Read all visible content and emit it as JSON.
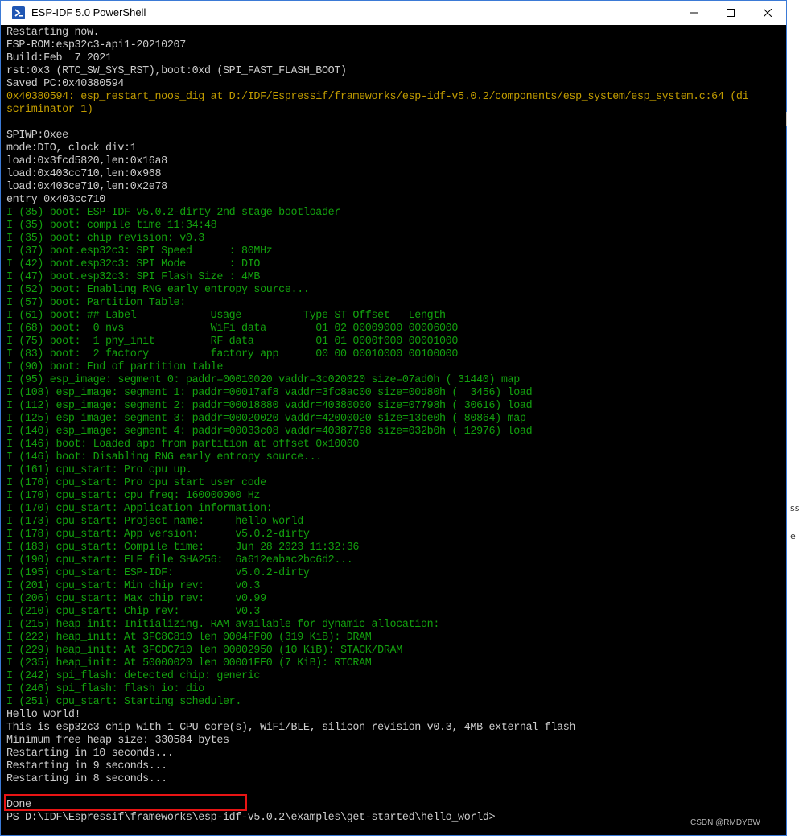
{
  "window": {
    "title": "ESP-IDF 5.0 PowerShell",
    "app_icon": "powershell-icon",
    "controls": [
      "minimize-icon",
      "maximize-icon",
      "close-icon"
    ]
  },
  "terminal": {
    "colors": {
      "default": "#c0c0c0",
      "log_info": "#13a10e",
      "warning": "#c19c00",
      "background": "#000000"
    },
    "lines": [
      {
        "text": "Restarting now.",
        "color": "gray"
      },
      {
        "text": "ESP-ROM:esp32c3-api1-20210207",
        "color": "gray"
      },
      {
        "text": "Build:Feb  7 2021",
        "color": "gray"
      },
      {
        "text": "rst:0x3 (RTC_SW_SYS_RST),boot:0xd (SPI_FAST_FLASH_BOOT)",
        "color": "gray"
      },
      {
        "text": "Saved PC:0x40380594",
        "color": "gray"
      },
      {
        "text": "0x40380594: esp_restart_noos_dig at D:/IDF/Espressif/frameworks/esp-idf-v5.0.2/components/esp_system/esp_system.c:64 (di",
        "color": "yellow"
      },
      {
        "text": "scriminator 1)",
        "color": "yellow"
      },
      {
        "text": "",
        "color": "gray"
      },
      {
        "text": "SPIWP:0xee",
        "color": "gray"
      },
      {
        "text": "mode:DIO, clock div:1",
        "color": "gray"
      },
      {
        "text": "load:0x3fcd5820,len:0x16a8",
        "color": "gray"
      },
      {
        "text": "load:0x403cc710,len:0x968",
        "color": "gray"
      },
      {
        "text": "load:0x403ce710,len:0x2e78",
        "color": "gray"
      },
      {
        "text": "entry 0x403cc710",
        "color": "gray"
      },
      {
        "text": "I (35) boot: ESP-IDF v5.0.2-dirty 2nd stage bootloader",
        "color": "green"
      },
      {
        "text": "I (35) boot: compile time 11:34:48",
        "color": "green"
      },
      {
        "text": "I (35) boot: chip revision: v0.3",
        "color": "green"
      },
      {
        "text": "I (37) boot.esp32c3: SPI Speed      : 80MHz",
        "color": "green"
      },
      {
        "text": "I (42) boot.esp32c3: SPI Mode       : DIO",
        "color": "green"
      },
      {
        "text": "I (47) boot.esp32c3: SPI Flash Size : 4MB",
        "color": "green"
      },
      {
        "text": "I (52) boot: Enabling RNG early entropy source...",
        "color": "green"
      },
      {
        "text": "I (57) boot: Partition Table:",
        "color": "green"
      },
      {
        "text": "I (61) boot: ## Label            Usage          Type ST Offset   Length",
        "color": "green"
      },
      {
        "text": "I (68) boot:  0 nvs              WiFi data        01 02 00009000 00006000",
        "color": "green"
      },
      {
        "text": "I (75) boot:  1 phy_init         RF data          01 01 0000f000 00001000",
        "color": "green"
      },
      {
        "text": "I (83) boot:  2 factory          factory app      00 00 00010000 00100000",
        "color": "green"
      },
      {
        "text": "I (90) boot: End of partition table",
        "color": "green"
      },
      {
        "text": "I (95) esp_image: segment 0: paddr=00010020 vaddr=3c020020 size=07ad0h ( 31440) map",
        "color": "green"
      },
      {
        "text": "I (108) esp_image: segment 1: paddr=00017af8 vaddr=3fc8ac00 size=00d80h (  3456) load",
        "color": "green"
      },
      {
        "text": "I (112) esp_image: segment 2: paddr=00018880 vaddr=40380000 size=07798h ( 30616) load",
        "color": "green"
      },
      {
        "text": "I (125) esp_image: segment 3: paddr=00020020 vaddr=42000020 size=13be0h ( 80864) map",
        "color": "green"
      },
      {
        "text": "I (140) esp_image: segment 4: paddr=00033c08 vaddr=40387798 size=032b0h ( 12976) load",
        "color": "green"
      },
      {
        "text": "I (146) boot: Loaded app from partition at offset 0x10000",
        "color": "green"
      },
      {
        "text": "I (146) boot: Disabling RNG early entropy source...",
        "color": "green"
      },
      {
        "text": "I (161) cpu_start: Pro cpu up.",
        "color": "green"
      },
      {
        "text": "I (170) cpu_start: Pro cpu start user code",
        "color": "green"
      },
      {
        "text": "I (170) cpu_start: cpu freq: 160000000 Hz",
        "color": "green"
      },
      {
        "text": "I (170) cpu_start: Application information:",
        "color": "green"
      },
      {
        "text": "I (173) cpu_start: Project name:     hello_world",
        "color": "green"
      },
      {
        "text": "I (178) cpu_start: App version:      v5.0.2-dirty",
        "color": "green"
      },
      {
        "text": "I (183) cpu_start: Compile time:     Jun 28 2023 11:32:36",
        "color": "green"
      },
      {
        "text": "I (190) cpu_start: ELF file SHA256:  6a612eabac2bc6d2...",
        "color": "green"
      },
      {
        "text": "I (195) cpu_start: ESP-IDF:          v5.0.2-dirty",
        "color": "green"
      },
      {
        "text": "I (201) cpu_start: Min chip rev:     v0.3",
        "color": "green"
      },
      {
        "text": "I (206) cpu_start: Max chip rev:     v0.99",
        "color": "green"
      },
      {
        "text": "I (210) cpu_start: Chip rev:         v0.3",
        "color": "green"
      },
      {
        "text": "I (215) heap_init: Initializing. RAM available for dynamic allocation:",
        "color": "green"
      },
      {
        "text": "I (222) heap_init: At 3FC8C810 len 0004FF00 (319 KiB): DRAM",
        "color": "green"
      },
      {
        "text": "I (229) heap_init: At 3FCDC710 len 00002950 (10 KiB): STACK/DRAM",
        "color": "green"
      },
      {
        "text": "I (235) heap_init: At 50000020 len 00001FE0 (7 KiB): RTCRAM",
        "color": "green"
      },
      {
        "text": "I (242) spi_flash: detected chip: generic",
        "color": "green"
      },
      {
        "text": "I (246) spi_flash: flash io: dio",
        "color": "green"
      },
      {
        "text": "I (251) cpu_start: Starting scheduler.",
        "color": "green"
      },
      {
        "text": "Hello world!",
        "color": "gray"
      },
      {
        "text": "This is esp32c3 chip with 1 CPU core(s), WiFi/BLE, silicon revision v0.3, 4MB external flash",
        "color": "gray"
      },
      {
        "text": "Minimum free heap size: 330584 bytes",
        "color": "gray"
      },
      {
        "text": "Restarting in 10 seconds...",
        "color": "gray"
      },
      {
        "text": "Restarting in 9 seconds...",
        "color": "gray"
      },
      {
        "text": "Restarting in 8 seconds...",
        "color": "gray"
      },
      {
        "text": "",
        "color": "gray"
      },
      {
        "text": "Done",
        "color": "gray"
      },
      {
        "text": "PS D:\\IDF\\Espressif\\frameworks\\esp-idf-v5.0.2\\examples\\get-started\\hello_world>",
        "color": "gray"
      }
    ]
  },
  "annotation": {
    "highlight_color": "#e81414"
  },
  "side": {
    "glyph1": "ss",
    "glyph2": "e"
  },
  "watermark": "CSDN @RMDYBW"
}
